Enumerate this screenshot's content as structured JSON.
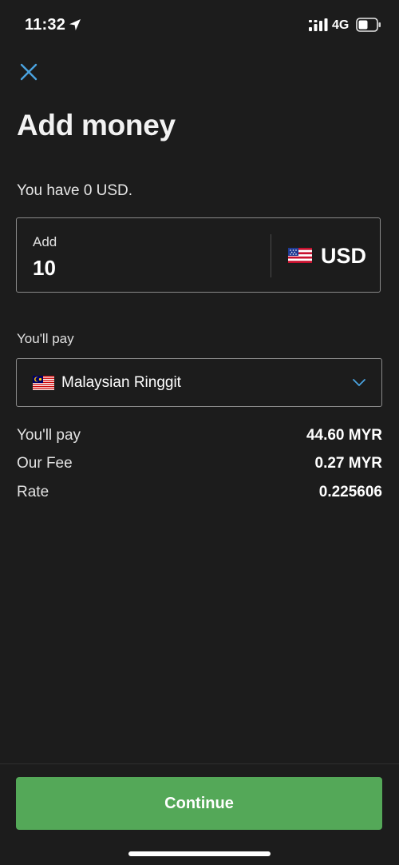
{
  "status_bar": {
    "time": "11:32",
    "network": "4G",
    "icons": [
      "location-arrow-icon",
      "signal-icon",
      "battery-icon"
    ]
  },
  "header": {
    "close_icon": "close-icon",
    "title": "Add money"
  },
  "balance": {
    "text": "You have 0 USD."
  },
  "amount": {
    "label": "Add",
    "value": "10",
    "currency": "USD",
    "flag_icon": "us-flag-icon"
  },
  "pay": {
    "label": "You'll pay",
    "currency_name": "Malaysian Ringgit",
    "flag_icon": "malaysia-flag-icon",
    "dropdown_icon": "chevron-down-icon"
  },
  "summary": [
    {
      "label": "You'll pay",
      "value": "44.60 MYR"
    },
    {
      "label": "Our Fee",
      "value": "0.27 MYR"
    },
    {
      "label": "Rate",
      "value": "0.225606"
    }
  ],
  "actions": {
    "continue_label": "Continue"
  },
  "colors": {
    "background": "#1c1c1c",
    "accent_blue": "#4aa3e0",
    "button_green": "#54a858",
    "border": "#8a8a8a"
  }
}
